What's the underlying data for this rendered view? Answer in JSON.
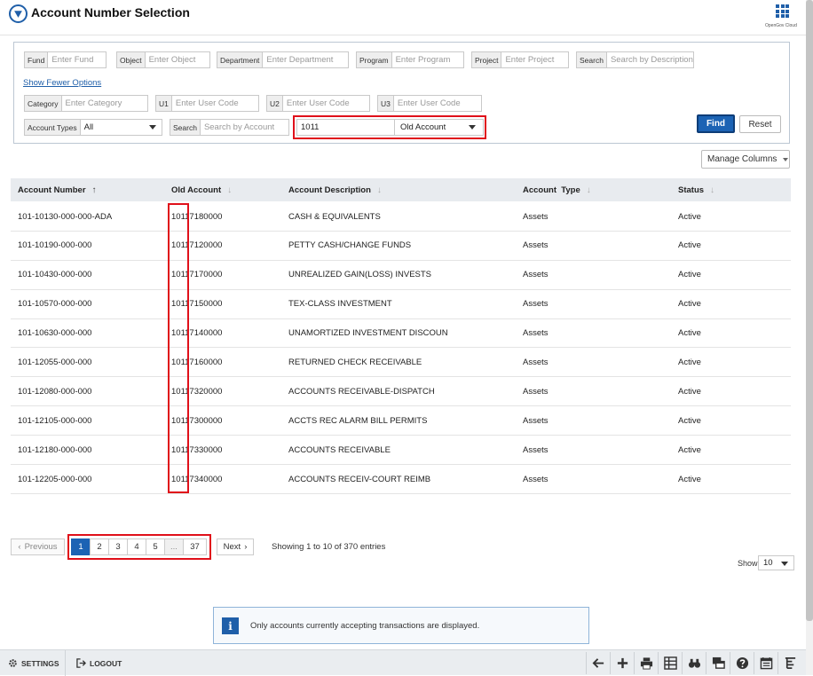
{
  "header": {
    "title": "Account Number Selection",
    "brand": "OpenGov Cloud",
    "logo_icon": "opengov-logo-icon",
    "apps_icon": "apps-grid-icon"
  },
  "filters": {
    "row1": [
      {
        "label": "Fund",
        "placeholder": "Enter Fund"
      },
      {
        "label": "Object",
        "placeholder": "Enter Object"
      },
      {
        "label": "Department",
        "placeholder": "Enter Department"
      },
      {
        "label": "Program",
        "placeholder": "Enter Program"
      },
      {
        "label": "Project",
        "placeholder": "Enter Project"
      },
      {
        "label": "Search",
        "placeholder": "Search by Description"
      }
    ],
    "show_fewer_link": "Show Fewer Options",
    "row2": [
      {
        "label": "Category",
        "placeholder": "Enter Category"
      },
      {
        "label": "U1",
        "placeholder": "Enter User Code"
      },
      {
        "label": "U2",
        "placeholder": "Enter User Code"
      },
      {
        "label": "U3",
        "placeholder": "Enter User Code"
      }
    ],
    "account_types": {
      "label": "Account Types",
      "value": "All"
    },
    "search_account": {
      "label": "Search",
      "placeholder": "Search by Account"
    },
    "account_search_value": "1011",
    "account_search_by": "Old Account",
    "find_label": "Find",
    "reset_label": "Reset"
  },
  "manage_columns_label": "Manage Columns",
  "table": {
    "columns": [
      "Account Number",
      "Old Account",
      "Account Description",
      "Account  Type",
      "Status"
    ],
    "rows": [
      [
        "101-10130-000-000-ADA",
        "10117180000",
        "CASH & EQUIVALENTS",
        "Assets",
        "Active"
      ],
      [
        "101-10190-000-000",
        "10117120000",
        "PETTY CASH/CHANGE FUNDS",
        "Assets",
        "Active"
      ],
      [
        "101-10430-000-000",
        "10117170000",
        "UNREALIZED GAIN(LOSS) INVESTS",
        "Assets",
        "Active"
      ],
      [
        "101-10570-000-000",
        "10117150000",
        "TEX-CLASS INVESTMENT",
        "Assets",
        "Active"
      ],
      [
        "101-10630-000-000",
        "10117140000",
        "UNAMORTIZED INVESTMENT DISCOUN",
        "Assets",
        "Active"
      ],
      [
        "101-12055-000-000",
        "10117160000",
        "RETURNED CHECK RECEIVABLE",
        "Assets",
        "Active"
      ],
      [
        "101-12080-000-000",
        "10117320000",
        "ACCOUNTS RECEIVABLE-DISPATCH",
        "Assets",
        "Active"
      ],
      [
        "101-12105-000-000",
        "10117300000",
        "ACCTS REC ALARM BILL PERMITS",
        "Assets",
        "Active"
      ],
      [
        "101-12180-000-000",
        "10117330000",
        "ACCOUNTS RECEIVABLE",
        "Assets",
        "Active"
      ],
      [
        "101-12205-000-000",
        "10117340000",
        "ACCOUNTS RECEIV-COURT REIMB",
        "Assets",
        "Active"
      ]
    ]
  },
  "pagination": {
    "previous_label": "Previous",
    "next_label": "Next",
    "pages": [
      "1",
      "2",
      "3",
      "4",
      "5",
      "...",
      "37"
    ],
    "current_page": "1",
    "info": "Showing 1 to 10 of 370 entries",
    "show_label": "Show",
    "page_size": "10"
  },
  "notice": {
    "text": "Only accounts currently accepting transactions are displayed."
  },
  "footer": {
    "settings_label": "SETTINGS",
    "logout_label": "LOGOUT"
  },
  "colors": {
    "accent": "#1c63b4",
    "highlight": "#e0101a",
    "header_bg": "#e8ebef"
  }
}
